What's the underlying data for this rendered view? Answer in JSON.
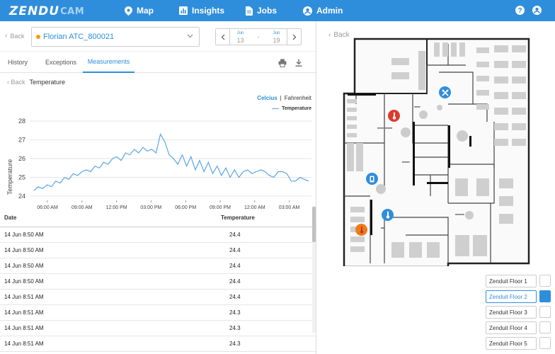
{
  "nav": {
    "logo_main": "ZENDU",
    "logo_sub": "CAM",
    "items": [
      {
        "label": "Map",
        "icon": "map-pin-icon"
      },
      {
        "label": "Insights",
        "icon": "bar-chart-icon"
      },
      {
        "label": "Jobs",
        "icon": "document-icon"
      },
      {
        "label": "Admin",
        "icon": "user-circle-icon"
      }
    ],
    "right_icons": [
      "help-icon",
      "account-icon"
    ]
  },
  "left": {
    "back_label": "Back",
    "device": {
      "name": "Florian ATC_800021",
      "status_color": "#f39c12"
    },
    "date_range": {
      "start": {
        "month": "Jun",
        "day": "13"
      },
      "end": {
        "month": "Jun",
        "day": "19"
      },
      "separator": "-"
    },
    "tabs": [
      "History",
      "Exceptions",
      "Measurements"
    ],
    "active_tab": "Measurements",
    "breadcrumb": {
      "back": "Back",
      "title": "Temperature"
    },
    "unit_toggle": {
      "active": "Celcius",
      "separator": "|",
      "inactive": "Fahrenheit"
    },
    "legend_label": "Temperature",
    "table": {
      "headers": {
        "date": "Date",
        "value": "Temperature"
      },
      "rows": [
        {
          "date": "14 Jun 8:50 AM",
          "value": "24.4"
        },
        {
          "date": "14 Jun 8:50 AM",
          "value": "24.4"
        },
        {
          "date": "14 Jun 8:50 AM",
          "value": "24.4"
        },
        {
          "date": "14 Jun 8:50 AM",
          "value": "24.4"
        },
        {
          "date": "14 Jun 8:51 AM",
          "value": "24.4"
        },
        {
          "date": "14 Jun 8:51 AM",
          "value": "24.3"
        },
        {
          "date": "14 Jun 8:51 AM",
          "value": "24.3"
        },
        {
          "date": "14 Jun 8:51 AM",
          "value": "24.3"
        }
      ]
    }
  },
  "chart_data": {
    "type": "line",
    "title": "",
    "xlabel": "",
    "ylabel": "Temperature",
    "ylim": [
      24,
      28
    ],
    "yticks": [
      "24",
      "25",
      "26",
      "27",
      "28"
    ],
    "xticks": [
      "06:00 AM",
      "09:00 AM",
      "12:00 PM",
      "03:00 PM",
      "06:00 PM",
      "09:00 PM",
      "12:00 AM",
      "03:00 AM"
    ],
    "grid": true,
    "legend": "top-right",
    "series": [
      {
        "name": "Temperature",
        "color": "#5aa6e6",
        "values": [
          24.3,
          24.5,
          24.4,
          24.6,
          24.5,
          24.8,
          24.7,
          25.0,
          24.9,
          25.2,
          25.1,
          25.3,
          25.4,
          25.3,
          25.6,
          25.5,
          25.8,
          25.7,
          26.0,
          26.1,
          25.9,
          26.3,
          26.2,
          26.5,
          26.3,
          26.6,
          26.4,
          26.5,
          26.3,
          27.3,
          26.9,
          26.2,
          26.0,
          25.7,
          26.2,
          25.6,
          26.1,
          25.4,
          25.9,
          25.3,
          25.8,
          25.2,
          25.6,
          25.1,
          25.5,
          25.0,
          25.4,
          25.0,
          25.3,
          25.4,
          25.2,
          25.3,
          25.4,
          25.3,
          25.1,
          25.0,
          25.3,
          25.3,
          25.2,
          24.8,
          24.8,
          25.0,
          24.9,
          24.8
        ]
      }
    ]
  },
  "right": {
    "back_label": "Back",
    "floors": [
      "Zenduit Floor 1",
      "Zenduit Floor 2",
      "Zenduit Floor 3",
      "Zenduit Floor 4",
      "Zenduit Floor 5"
    ],
    "active_floor": "Zenduit Floor 2",
    "pins": [
      {
        "icon": "tools-icon",
        "color": "#2f8edc"
      },
      {
        "icon": "thermometer-icon",
        "color": "#e03a2e"
      },
      {
        "icon": "device-icon",
        "color": "#2f8edc"
      },
      {
        "icon": "thermometer-icon",
        "color": "#2f8edc"
      },
      {
        "icon": "thermometer-icon",
        "color": "#f07a1a"
      }
    ]
  }
}
